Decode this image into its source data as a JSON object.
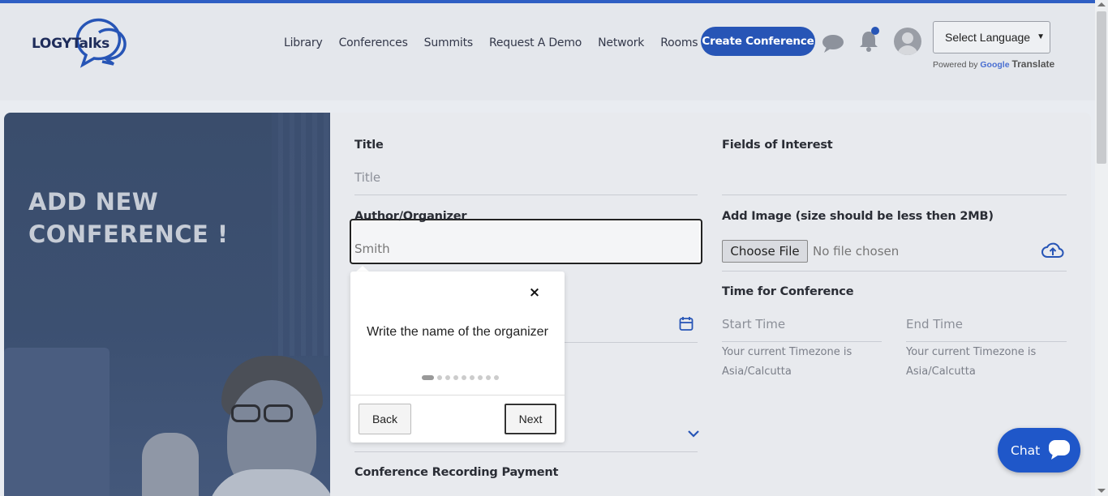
{
  "brand": {
    "logo_text_a": "LOGY",
    "logo_text_b": "Talks",
    "primary_color": "#2755b6"
  },
  "nav": {
    "items": [
      {
        "label": "Library"
      },
      {
        "label": "Conferences"
      },
      {
        "label": "Summits"
      },
      {
        "label": "Request A Demo"
      },
      {
        "label": "Network"
      },
      {
        "label": "Rooms"
      }
    ],
    "create_label": "Create Conference"
  },
  "language": {
    "selected": "Select Language",
    "powered_by": "Powered by",
    "google": "Google",
    "translate": "Translate"
  },
  "hero": {
    "title_line1": "ADD NEW",
    "title_line2": "CONFERENCE !"
  },
  "form": {
    "title_label": "Title",
    "title_placeholder": "Title",
    "author_label": "Author/Organizer",
    "author_value": "Smith",
    "fields_label": "Fields of Interest",
    "image_label": "Add Image (size should be less then 2MB)",
    "file_button": "Choose File",
    "file_status": "No file chosen",
    "time_label": "Time for Conference",
    "start_placeholder": "Start Time",
    "end_placeholder": "End Time",
    "tz_note_line1": "Your current Timezone is",
    "tz_note_line2": "Asia/Calcutta",
    "recording_label": "Conference Recording Payment"
  },
  "tour": {
    "text": "Write the name of the organizer",
    "close": "×",
    "back": "Back",
    "next": "Next",
    "step": 1,
    "total_steps": 9
  },
  "chat": {
    "label": "Chat"
  }
}
